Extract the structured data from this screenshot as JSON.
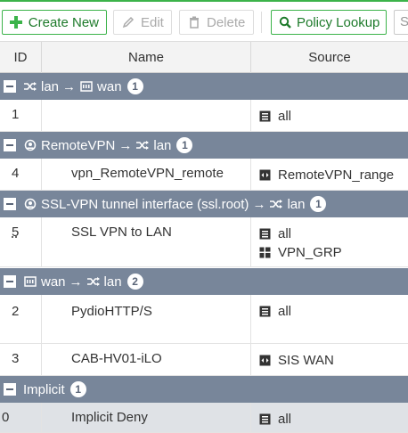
{
  "toolbar": {
    "create_label": "Create New",
    "edit_label": "Edit",
    "delete_label": "Delete",
    "lookup_label": "Policy Lookup",
    "search_partial": "S"
  },
  "table": {
    "headers": {
      "id": "ID",
      "name": "Name",
      "source": "Source"
    },
    "groups": [
      {
        "from": "lan",
        "arrow": "→",
        "to": "wan",
        "count": "1"
      },
      {
        "from": "RemoteVPN",
        "arrow": "→",
        "to": "lan",
        "count": "1"
      },
      {
        "from": "SSL-VPN tunnel interface (ssl.root)",
        "arrow": "→",
        "to": "lan",
        "count": "1"
      },
      {
        "from": "wan",
        "arrow": "→",
        "to": "lan",
        "count": "2"
      },
      {
        "label": "Implicit",
        "count": "1"
      }
    ],
    "rows": [
      {
        "id": "1",
        "name": "",
        "sources": [
          "all"
        ]
      },
      {
        "id": "4",
        "name": "vpn_RemoteVPN_remote",
        "sources": [
          "RemoteVPN_range"
        ]
      },
      {
        "id": "5",
        "name": "SSL VPN to LAN",
        "sources": [
          "all",
          "VPN_GRP"
        ]
      },
      {
        "id": "2",
        "name": "PydioHTTP/S",
        "sources": [
          "all"
        ]
      },
      {
        "id": "3",
        "name": "CAB-HV01-iLO",
        "sources": [
          "SIS WAN"
        ]
      },
      {
        "id": "0",
        "name": "Implicit Deny",
        "sources": [
          "all"
        ]
      }
    ]
  },
  "colors": {
    "accent": "#3cb34a",
    "group_bg": "#78869a",
    "header_bg": "#f3f3f3",
    "shaded_row": "#dfe2e6"
  },
  "icons": {
    "create": "plus-icon",
    "edit": "pencil-icon",
    "delete": "trash-icon",
    "lookup": "search-icon",
    "lan": "shuffle-icon",
    "wan": "network-port-icon",
    "vpn": "vpn-tunnel-icon",
    "address": "address-list-icon",
    "range": "address-range-icon",
    "group": "address-group-icon"
  }
}
